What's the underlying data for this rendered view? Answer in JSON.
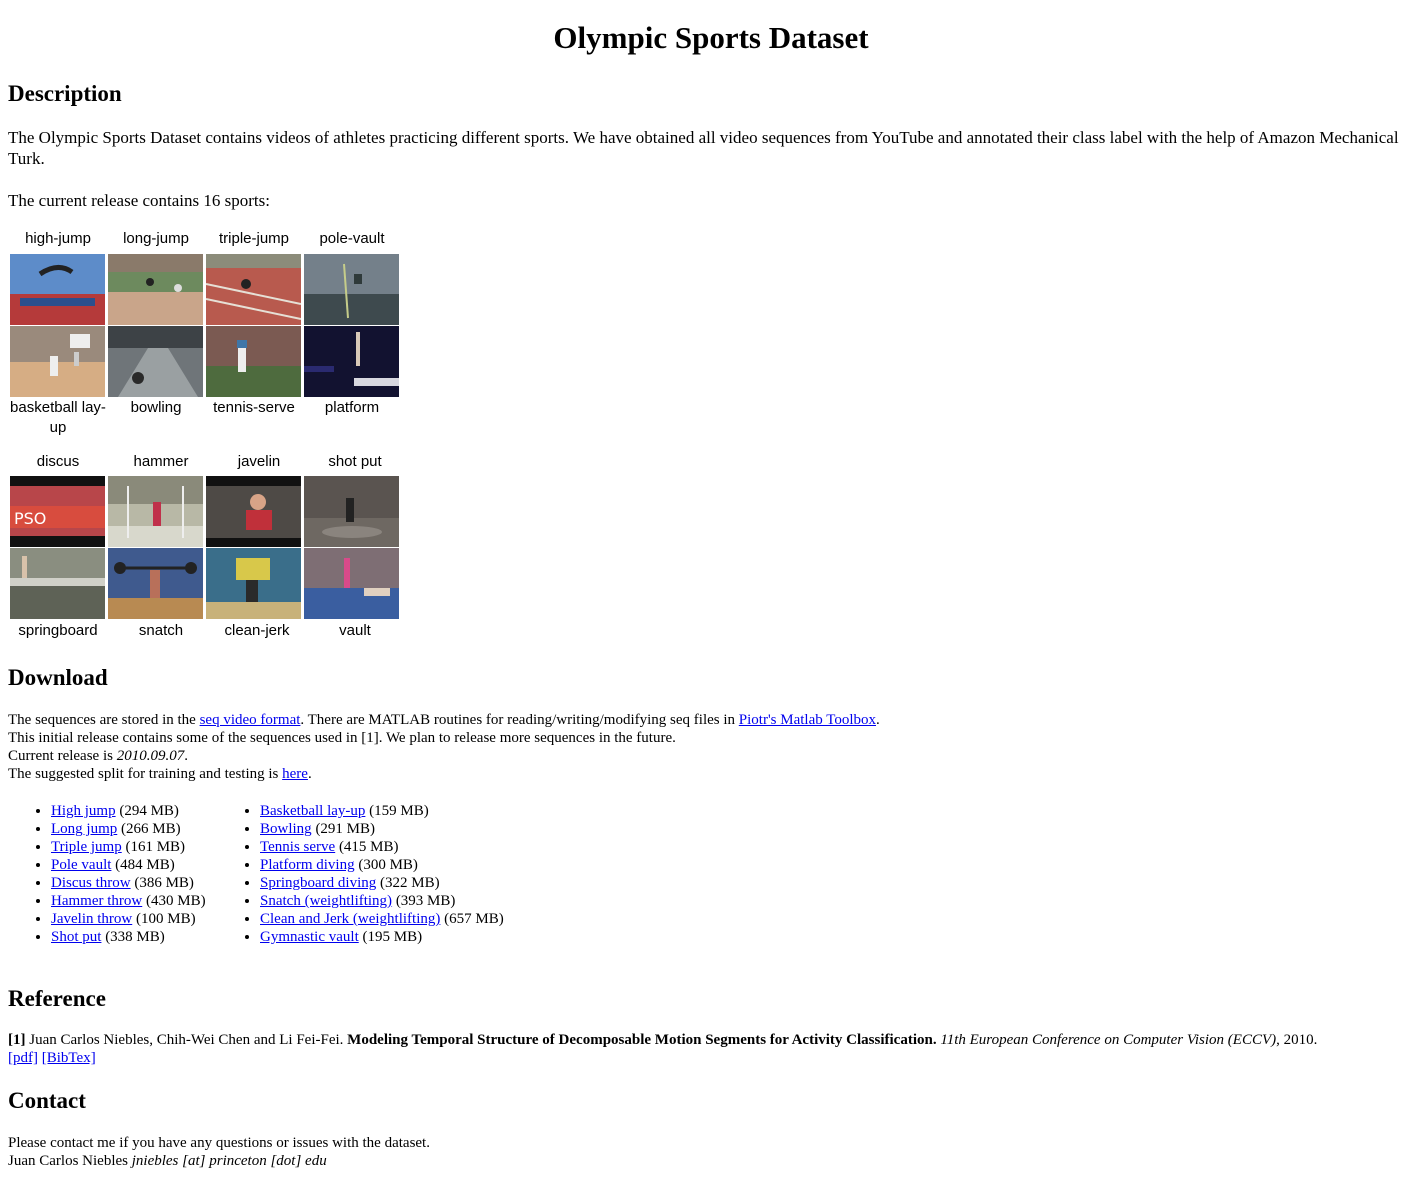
{
  "title": "Olympic Sports Dataset",
  "description": {
    "heading": "Description",
    "intro": "The Olympic Sports Dataset contains videos of athletes practicing different sports. We have obtained all video sequences from YouTube and annotated their class label with the help of Amazon Mechanical Turk.",
    "count_text": "The current release contains 16 sports:"
  },
  "sports_grid": {
    "group1": {
      "top_labels": [
        "high-jump",
        "long-jump",
        "triple-jump",
        "pole-vault"
      ],
      "bottom_labels": [
        "basketball lay-up",
        "bowling",
        "tennis-serve",
        "platform"
      ]
    },
    "group2": {
      "top_labels": [
        "discus",
        "hammer",
        "javelin",
        "shot put"
      ],
      "bottom_labels": [
        "springboard",
        "snatch",
        "clean-jerk",
        "vault"
      ]
    }
  },
  "download": {
    "heading": "Download",
    "line1_pre": "The sequences are stored in the ",
    "line1_link1": "seq video format",
    "line1_mid": ". There are MATLAB routines for reading/writing/modifying seq files in ",
    "line1_link2": "Piotr's Matlab Toolbox",
    "line1_post": ".",
    "line2": "This initial release contains some of the sequences used in [1]. We plan to release more sequences in the future.",
    "line3_pre": "Current release is ",
    "line3_version": "2010.09.07",
    "line3_post": ".",
    "line4_pre": "The suggested split for training and testing is ",
    "line4_link": "here",
    "line4_post": ".",
    "left_list": [
      {
        "name": "High jump",
        "size": "(294 MB)"
      },
      {
        "name": "Long jump",
        "size": "(266 MB)"
      },
      {
        "name": "Triple jump",
        "size": "(161 MB)"
      },
      {
        "name": "Pole vault",
        "size": "(484 MB)"
      },
      {
        "name": "Discus throw",
        "size": "(386 MB)"
      },
      {
        "name": "Hammer throw",
        "size": "(430 MB)"
      },
      {
        "name": "Javelin throw",
        "size": "(100 MB)"
      },
      {
        "name": "Shot put",
        "size": "(338 MB)"
      }
    ],
    "right_list": [
      {
        "name": "Basketball lay-up",
        "size": "(159 MB)"
      },
      {
        "name": "Bowling",
        "size": "(291 MB)"
      },
      {
        "name": "Tennis serve",
        "size": "(415 MB)"
      },
      {
        "name": "Platform diving",
        "size": "(300 MB)"
      },
      {
        "name": "Springboard diving",
        "size": "(322 MB)"
      },
      {
        "name": "Snatch (weightlifting)",
        "size": "(393 MB)"
      },
      {
        "name": "Clean and Jerk (weightlifting)",
        "size": "(657 MB)"
      },
      {
        "name": "Gymnastic vault",
        "size": "(195 MB)"
      }
    ]
  },
  "reference": {
    "heading": "Reference",
    "num": "[1]",
    "authors": " Juan Carlos Niebles, Chih-Wei Chen and Li Fei-Fei. ",
    "title": "Modeling Temporal Structure of Decomposable Motion Segments for Activity Classification.",
    "venue": "11th European Conference on Computer Vision (ECCV)",
    "year": ", 2010.",
    "pdf": "[pdf]",
    "bibtex": "[BibTex]"
  },
  "contact": {
    "heading": "Contact",
    "line1": "Please contact me if you have any questions or issues with the dataset.",
    "name": "Juan Carlos Niebles",
    "email": "jniebles [at] princeton [dot] edu"
  },
  "colors": {
    "link": "#0000ee",
    "text": "#000000",
    "background": "#ffffff"
  }
}
